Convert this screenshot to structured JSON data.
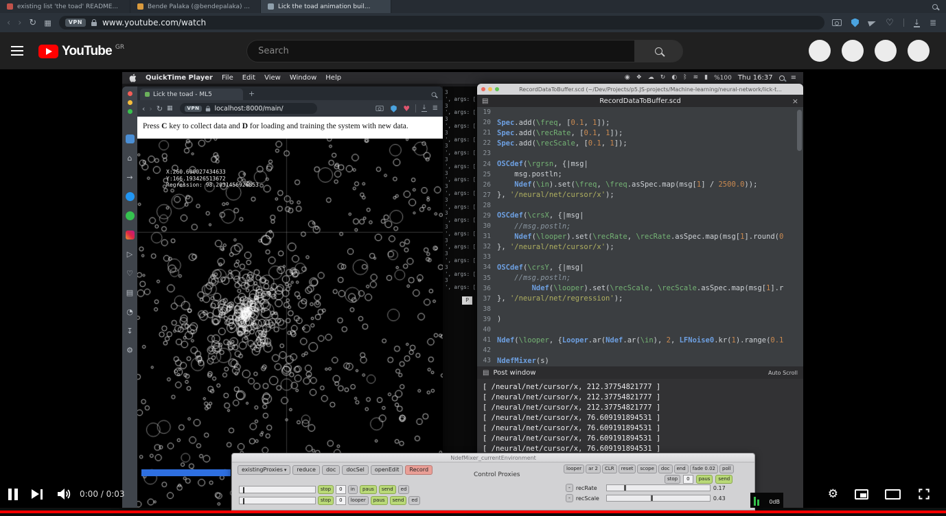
{
  "browser": {
    "tabs": [
      {
        "label": "existing list 'the toad' README...",
        "favicon_color": "#c0524a"
      },
      {
        "label": "Bende Palaka (@bendepalaka) ...",
        "favicon_color": "#d99a3d"
      },
      {
        "label": "Lick the toad animation buil...",
        "favicon_color": "#8fa0ac",
        "active": true
      }
    ],
    "address": {
      "vpn": "VPN",
      "url": "www.youtube.com/watch"
    }
  },
  "masthead": {
    "logo": "YouTube",
    "region": "GR",
    "search_placeholder": "Search",
    "avatar_count": 4
  },
  "player": {
    "time": "0:00 / 0:03"
  },
  "mac": {
    "menubar": {
      "app": "QuickTime Player",
      "menus": [
        "File",
        "Edit",
        "View",
        "Window",
        "Help"
      ],
      "status_icons": [
        "record",
        "mirror",
        "cloud",
        "sync",
        "display",
        "bluetooth",
        "wifi",
        "battery"
      ],
      "battery": "%100",
      "clock": "Thu 16:37"
    },
    "web": {
      "tab": "Lick the toad - ML5",
      "vpn": "VPN",
      "url": "localhost:8000/main/",
      "instruction": [
        {
          "text": "Press "
        },
        {
          "text": "C",
          "bold": true
        },
        {
          "text": " key to collect data and "
        },
        {
          "text": "D",
          "bold": true
        },
        {
          "text": " for loading and training the system with new data."
        }
      ],
      "overlay": [
        "X:260.600027434633",
        "Y:166.193426513672",
        "Regression: 98.2031456926853"
      ],
      "sidebar_icons": [
        "spaces",
        "home",
        "flow",
        "messenger",
        "whatsapp",
        "instagram",
        "player",
        "heart",
        "bookmarks",
        "history",
        "downloads",
        "settings"
      ]
    },
    "console_lines": [
      "3",
      "', args: [",
      "3",
      "', args: [",
      "3",
      "', args: [",
      "3",
      "', args: [",
      "3",
      "', args: [",
      "3",
      "', args: [",
      "3",
      "', args: [",
      "3",
      "', args: [",
      "3",
      "', args: [",
      "3",
      "', args: [",
      "3",
      "', args: [",
      "3",
      "', args: [",
      "3",
      "', args: [",
      "3",
      "', args: [",
      "3",
      "', args: ["
    ],
    "console_panel": "P",
    "sc": {
      "window_title": "RecordDataToBuffer.scd (~/Dev/Projects/p5.JS-projects/Machine-learning/neural-network/lick-t...",
      "tab": "RecordDataToBuffer.scd",
      "close_glyph": "×",
      "first_line": 19,
      "code": [
        "",
        "Spec.add(\\freq, [0.1, 1]);",
        "Spec.add(\\recRate, [0.1, 1]);",
        "Spec.add(\\recScale, [0.1, 1]);",
        "",
        "OSCdef(\\rgrsn, {|msg|",
        "    msg.postln;",
        "    Ndef(\\in).set(\\freq, \\freq.asSpec.map(msg[1] / 2500.0));",
        "}, '/neural/net/cursor/x');",
        "",
        "OSCdef(\\crsX, {|msg|",
        "    //msg.postln;",
        "    Ndef(\\looper).set(\\recRate, \\recRate.asSpec.map(msg[1].round(0",
        "}, '/neural/net/cursor/x');",
        "",
        "OSCdef(\\crsY, {|msg|",
        "    //msg.postln;",
        "        Ndef(\\looper).set(\\recScale, \\recScale.asSpec.map(msg[1].r",
        "}, '/neural/net/regression');",
        "",
        ")",
        "",
        "Ndef(\\looper, {Looper.ar(Ndef.ar(\\in), 2, LFNoise0.kr(1).range(0.1",
        "",
        "NdefMixer(s)"
      ],
      "post_title": "Post window",
      "auto_scroll": "Auto Scroll",
      "post_lines": [
        "[ /neural/net/cursor/x, 212.37754821777 ]",
        "[ /neural/net/cursor/x, 212.37754821777 ]",
        "[ /neural/net/cursor/x, 212.37754821777 ]",
        "[ /neural/net/cursor/x, 76.609191894531 ]",
        "[ /neural/net/cursor/x, 76.609191894531 ]",
        "[ /neural/net/cursor/x, 76.609191894531 ]",
        "[ /neural/net/cursor/x, 76.609191894531 ]"
      ],
      "meter": "0dB"
    },
    "mixer": {
      "title": "NdefMixer_currentEnvironment",
      "top_buttons": [
        "existingProxies",
        "reduce",
        "doc",
        "docSel",
        "openEdit",
        "Record"
      ],
      "center_label": "Control Proxies",
      "proxy_buttons": [
        "looper",
        "ar 2",
        "CLR",
        "reset",
        "scope",
        "doc",
        "end",
        "fade 0.02",
        "poll"
      ],
      "proxy_row2": [
        "stop",
        "0",
        "paus",
        "send"
      ],
      "params": [
        {
          "name": "recRate",
          "value": "0.17",
          "pct": 17
        },
        {
          "name": "recScale",
          "value": "0.43",
          "pct": 43
        }
      ],
      "channel_rows": [
        {
          "buttons": [
            "stop",
            "0",
            "in",
            "paus",
            "send",
            "ed"
          ]
        },
        {
          "buttons": [
            "stop",
            "0",
            "looper",
            "paus",
            "send",
            "ed"
          ]
        }
      ]
    }
  },
  "canvas_dots": {
    "seed": 11,
    "uniform": 520,
    "cluster": 300,
    "large": 45
  }
}
